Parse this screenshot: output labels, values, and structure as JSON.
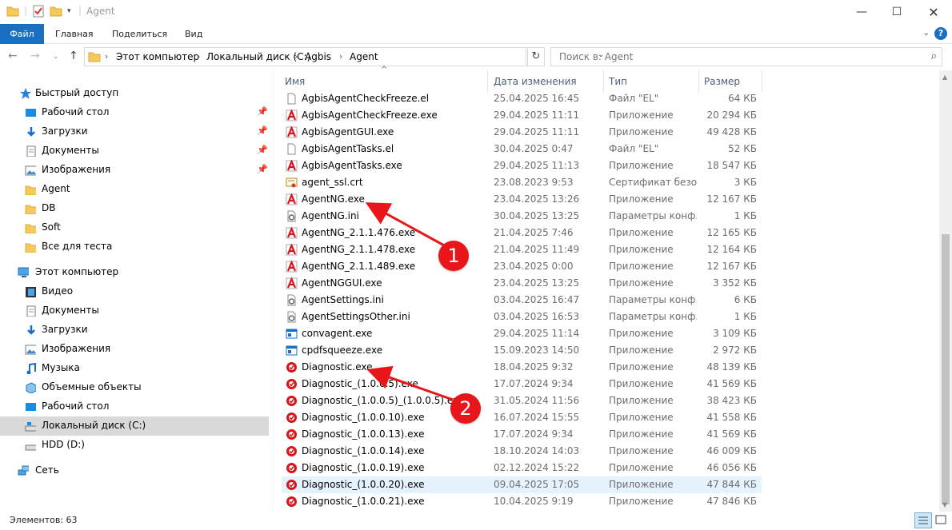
{
  "window": {
    "title": "Agent"
  },
  "ribbon": {
    "tabs": [
      "Файл",
      "Главная",
      "Поделиться",
      "Вид"
    ],
    "help": "?"
  },
  "address": {
    "crumbs": [
      "Этот компьютер",
      "Локальный диск (C:)",
      "Agbis",
      "Agent"
    ],
    "search_placeholder": "Поиск в: Agent"
  },
  "sidebar": {
    "quick_access": "Быстрый доступ",
    "quick_items": [
      {
        "label": "Рабочий стол",
        "icon": "desktop-icon",
        "pinned": true
      },
      {
        "label": "Загрузки",
        "icon": "downloads-icon",
        "pinned": true
      },
      {
        "label": "Документы",
        "icon": "documents-icon",
        "pinned": true
      },
      {
        "label": "Изображения",
        "icon": "pictures-icon",
        "pinned": true
      },
      {
        "label": "Agent",
        "icon": "folder-icon",
        "pinned": false
      },
      {
        "label": "DB",
        "icon": "folder-icon",
        "pinned": false
      },
      {
        "label": "Soft",
        "icon": "folder-icon",
        "pinned": false
      },
      {
        "label": "Все для теста",
        "icon": "folder-icon",
        "pinned": false
      }
    ],
    "this_pc": "Этот компьютер",
    "pc_items": [
      {
        "label": "Видео",
        "icon": "video-icon"
      },
      {
        "label": "Документы",
        "icon": "documents-icon"
      },
      {
        "label": "Загрузки",
        "icon": "downloads-icon"
      },
      {
        "label": "Изображения",
        "icon": "pictures-icon"
      },
      {
        "label": "Музыка",
        "icon": "music-icon"
      },
      {
        "label": "Объемные объекты",
        "icon": "3d-objects-icon"
      },
      {
        "label": "Рабочий стол",
        "icon": "desktop-icon"
      },
      {
        "label": "Локальный диск (C:)",
        "icon": "drive-c-icon"
      },
      {
        "label": "HDD (D:)",
        "icon": "drive-d-icon"
      }
    ],
    "network": "Сеть"
  },
  "columns": {
    "name": "Имя",
    "date": "Дата изменения",
    "type": "Тип",
    "size": "Размер"
  },
  "files": [
    {
      "name": "AgbisAgentCheckFreeze.el",
      "date": "25.04.2025 16:45",
      "type": "Файл \"EL\"",
      "size": "64 КБ",
      "icon": "blank"
    },
    {
      "name": "AgbisAgentCheckFreeze.exe",
      "date": "29.04.2025 11:11",
      "type": "Приложение",
      "size": "20 294 КБ",
      "icon": "agbis"
    },
    {
      "name": "AgbisAgentGUI.exe",
      "date": "29.04.2025 11:11",
      "type": "Приложение",
      "size": "49 428 КБ",
      "icon": "agbis"
    },
    {
      "name": "AgbisAgentTasks.el",
      "date": "30.04.2025 0:47",
      "type": "Файл \"EL\"",
      "size": "52 КБ",
      "icon": "blank"
    },
    {
      "name": "AgbisAgentTasks.exe",
      "date": "29.04.2025 11:13",
      "type": "Приложение",
      "size": "18 547 КБ",
      "icon": "agbis"
    },
    {
      "name": "agent_ssl.crt",
      "date": "23.08.2023 9:53",
      "type": "Сертификат безо...",
      "size": "3 КБ",
      "icon": "cert"
    },
    {
      "name": "AgentNG.exe",
      "date": "23.04.2025 13:26",
      "type": "Приложение",
      "size": "12 167 КБ",
      "icon": "agbis-gray"
    },
    {
      "name": "AgentNG.ini",
      "date": "30.04.2025 13:25",
      "type": "Параметры конф...",
      "size": "1 КБ",
      "icon": "ini"
    },
    {
      "name": "AgentNG_2.1.1.476.exe",
      "date": "21.04.2025 7:46",
      "type": "Приложение",
      "size": "12 165 КБ",
      "icon": "agbis"
    },
    {
      "name": "AgentNG_2.1.1.478.exe",
      "date": "21.04.2025 11:49",
      "type": "Приложение",
      "size": "12 164 КБ",
      "icon": "agbis"
    },
    {
      "name": "AgentNG_2.1.1.489.exe",
      "date": "23.04.2025 0:00",
      "type": "Приложение",
      "size": "12 167 КБ",
      "icon": "agbis"
    },
    {
      "name": "AgentNGGUI.exe",
      "date": "23.04.2025 13:25",
      "type": "Приложение",
      "size": "3 352 КБ",
      "icon": "agbis-gray"
    },
    {
      "name": "AgentSettings.ini",
      "date": "03.04.2025 16:47",
      "type": "Параметры конф...",
      "size": "6 КБ",
      "icon": "ini"
    },
    {
      "name": "AgentSettingsOther.ini",
      "date": "03.04.2025 16:53",
      "type": "Параметры конф...",
      "size": "1 КБ",
      "icon": "ini"
    },
    {
      "name": "convagent.exe",
      "date": "29.04.2025 11:14",
      "type": "Приложение",
      "size": "3 109 КБ",
      "icon": "app"
    },
    {
      "name": "cpdfsqueeze.exe",
      "date": "15.09.2023 14:50",
      "type": "Приложение",
      "size": "2 972 КБ",
      "icon": "app"
    },
    {
      "name": "Diagnostic.exe",
      "date": "18.04.2025 9:32",
      "type": "Приложение",
      "size": "48 139 КБ",
      "icon": "diag"
    },
    {
      "name": "Diagnostic_(1.0.0.5).exe",
      "date": "17.07.2024 9:34",
      "type": "Приложение",
      "size": "41 569 КБ",
      "icon": "diag"
    },
    {
      "name": "Diagnostic_(1.0.0.5)_(1.0.0.5).exe",
      "date": "31.05.2024 11:56",
      "type": "Приложение",
      "size": "38 423 КБ",
      "icon": "diag"
    },
    {
      "name": "Diagnostic_(1.0.0.10).exe",
      "date": "16.07.2024 15:55",
      "type": "Приложение",
      "size": "41 558 КБ",
      "icon": "diag"
    },
    {
      "name": "Diagnostic_(1.0.0.13).exe",
      "date": "17.07.2024 9:34",
      "type": "Приложение",
      "size": "41 569 КБ",
      "icon": "diag"
    },
    {
      "name": "Diagnostic_(1.0.0.14).exe",
      "date": "18.10.2024 14:03",
      "type": "Приложение",
      "size": "46 009 КБ",
      "icon": "diag"
    },
    {
      "name": "Diagnostic_(1.0.0.19).exe",
      "date": "02.12.2024 15:22",
      "type": "Приложение",
      "size": "46 056 КБ",
      "icon": "diag"
    },
    {
      "name": "Diagnostic_(1.0.0.20).exe",
      "date": "09.04.2025 17:05",
      "type": "Приложение",
      "size": "47 844 КБ",
      "icon": "diag",
      "hover": true
    },
    {
      "name": "Diagnostic_(1.0.0.21).exe",
      "date": "10.04.2025 9:19",
      "type": "Приложение",
      "size": "47 846 КБ",
      "icon": "diag"
    }
  ],
  "status": {
    "count": "Элементов: 63"
  },
  "annotations": [
    {
      "label": "1"
    },
    {
      "label": "2"
    }
  ],
  "colors": {
    "accent": "#1a6fc1",
    "badge": "#e8161b",
    "selected_nav": "#d9d9d9",
    "hover_row": "#e5f3ff"
  }
}
